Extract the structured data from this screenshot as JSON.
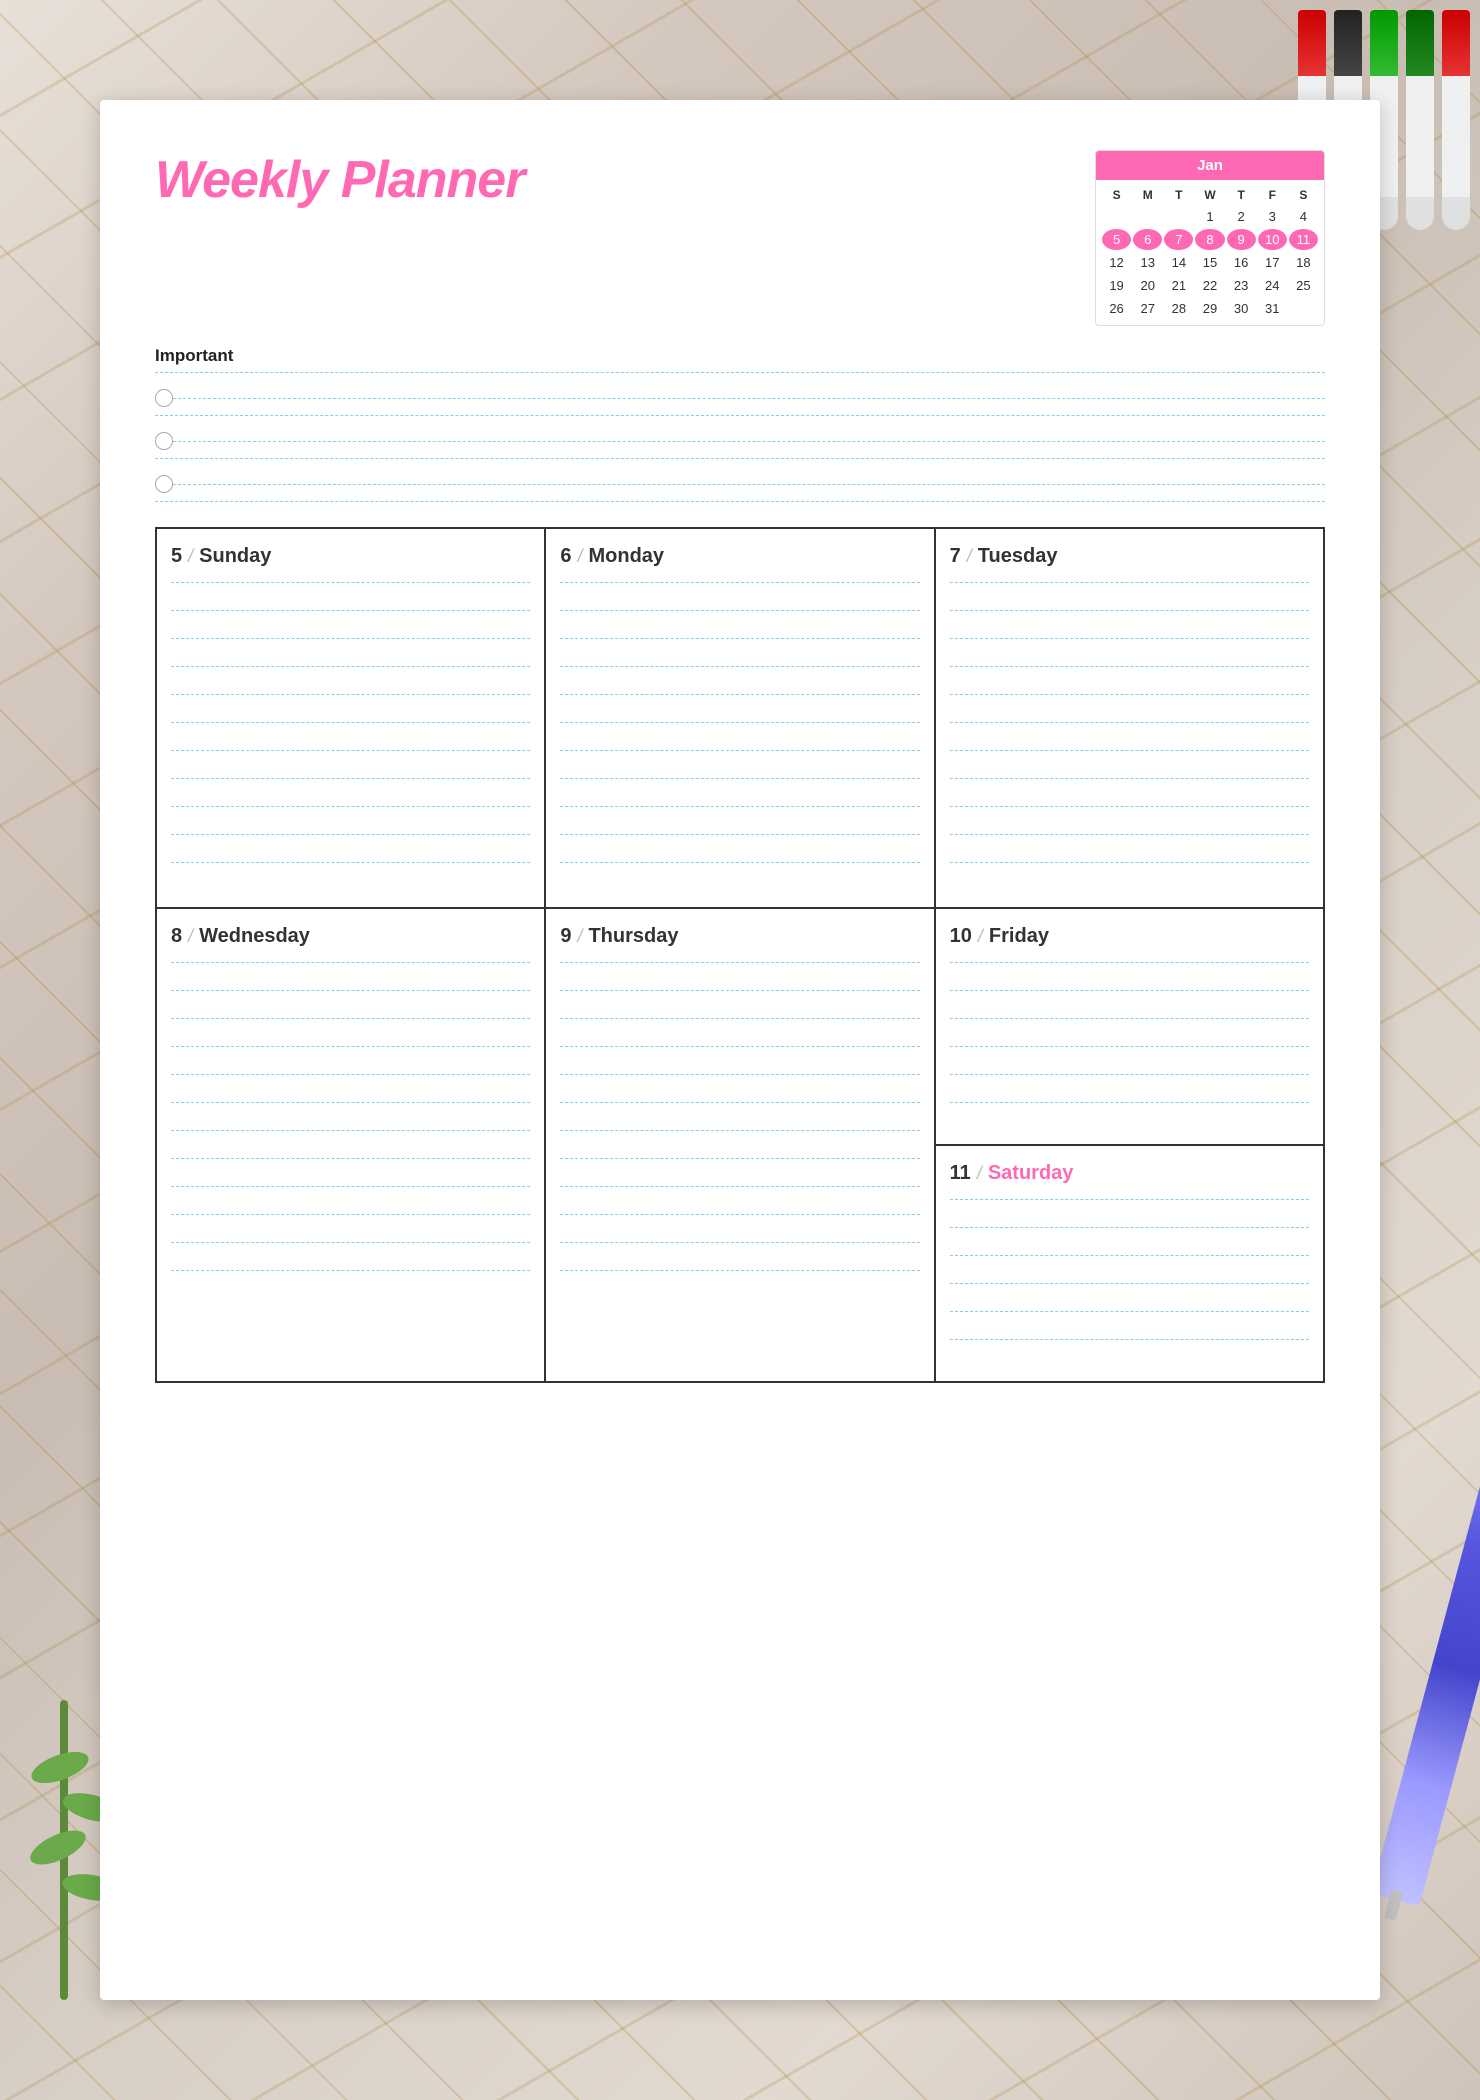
{
  "background": {
    "color": "#d4c9c0"
  },
  "title": "Weekly Planner",
  "calendar": {
    "month": "January",
    "month_short": "Jan",
    "days_of_week": [
      "S",
      "M",
      "T",
      "W",
      "T",
      "F",
      "S"
    ],
    "rows": [
      [
        "",
        "",
        "",
        "1",
        "2",
        "3",
        "4"
      ],
      [
        "5",
        "6",
        "7",
        "8",
        "9",
        "10",
        "11"
      ],
      [
        "12",
        "13",
        "14",
        "15",
        "16",
        "17",
        "18"
      ],
      [
        "19",
        "20",
        "21",
        "22",
        "23",
        "24",
        "25"
      ],
      [
        "26",
        "27",
        "28",
        "29",
        "30",
        "31",
        ""
      ]
    ],
    "highlighted": [
      "5",
      "6",
      "7",
      "8",
      "9",
      "10",
      "11"
    ]
  },
  "important": {
    "label": "Important",
    "items": [
      "",
      "",
      ""
    ]
  },
  "days": [
    {
      "num": "5",
      "name": "Sunday",
      "is_saturday": false
    },
    {
      "num": "6",
      "name": "Monday",
      "is_saturday": false
    },
    {
      "num": "7",
      "name": "Tuesday",
      "is_saturday": false
    },
    {
      "num": "8",
      "name": "Wednesday",
      "is_saturday": false
    },
    {
      "num": "9",
      "name": "Thursday",
      "is_saturday": false
    },
    {
      "num": "10",
      "name": "Friday",
      "is_saturday": false
    },
    {
      "num": "11",
      "name": "Saturday",
      "is_saturday": true
    }
  ],
  "slash": "/"
}
